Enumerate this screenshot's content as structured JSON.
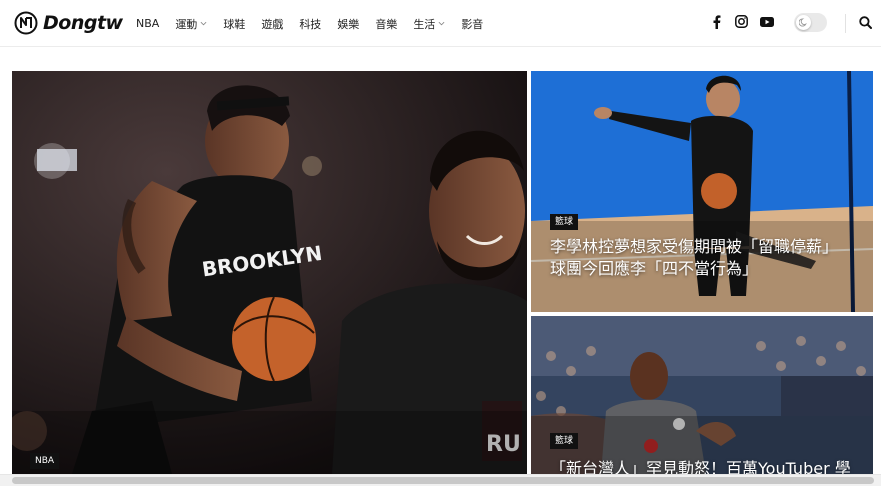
{
  "brand": {
    "name": "Dongtw"
  },
  "nav": {
    "items": [
      {
        "label": "NBA",
        "dropdown": false
      },
      {
        "label": "運動",
        "dropdown": true
      },
      {
        "label": "球鞋",
        "dropdown": false
      },
      {
        "label": "遊戲",
        "dropdown": false
      },
      {
        "label": "科技",
        "dropdown": false
      },
      {
        "label": "娛樂",
        "dropdown": false
      },
      {
        "label": "音樂",
        "dropdown": false
      },
      {
        "label": "生活",
        "dropdown": true
      },
      {
        "label": "影音",
        "dropdown": false
      }
    ]
  },
  "social": {
    "icons": [
      "facebook-icon",
      "instagram-icon",
      "youtube-icon"
    ]
  },
  "theme_toggle": {
    "icon": "moon-icon",
    "state": "light"
  },
  "hero": {
    "main": {
      "category": "NBA"
    },
    "right_top": {
      "category": "籃球",
      "title_line1": "李學林控夢想家受傷期間被「留職停薪」",
      "title_line2": "球團今回應李「四不當行為」"
    },
    "right_bottom": {
      "category": "籃球",
      "title_line1": "「新台灣人」罕見動怒！百萬YouTuber 學"
    }
  },
  "colors": {
    "accent": "#111111",
    "badge_bg": "#111111"
  }
}
